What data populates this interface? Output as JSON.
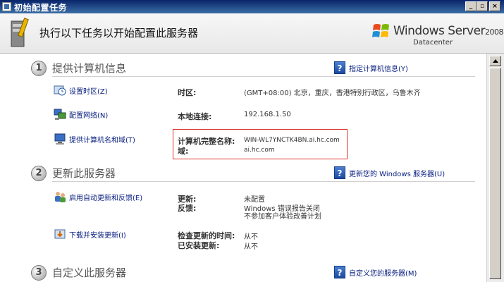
{
  "window": {
    "title": "初始配置任务"
  },
  "header": {
    "instruction": "执行以下任务以开始配置此服务器",
    "brand_name": "Windows Server",
    "brand_version": "2008",
    "brand_edition": "Datacenter"
  },
  "sections": [
    {
      "number": "1",
      "title": "提供计算机信息",
      "help_label": "指定计算机信息(Y)",
      "tasks": [
        {
          "label": "设置时区(Z)",
          "info_label": "时区:",
          "info_value": "(GMT+08:00) 北京，重庆，香港特别行政区，乌鲁木齐"
        },
        {
          "label": "配置网络(N)",
          "info_label": "本地连接:",
          "info_value": "192.168.1.50"
        },
        {
          "label": "提供计算机名和域(T)",
          "info_label": "计算机完整名称:",
          "info_value": "WIN-WL7YNCTK4BN.ai.hc.com",
          "info_label2": "域:",
          "info_value2": "ai.hc.com"
        }
      ]
    },
    {
      "number": "2",
      "title": "更新此服务器",
      "help_label": "更新您的 Windows 服务器(U)",
      "tasks": [
        {
          "label": "启用自动更新和反馈(E)",
          "info_label": "更新:",
          "info_value": "未配置",
          "info_label2": "反馈:",
          "info_value2": "Windows 错误报告关闭",
          "info_value3": "不参加客户体验改善计划"
        },
        {
          "label": "下载并安装更新(I)",
          "info_label": "检查更新的时间:",
          "info_value": "从不",
          "info_label2": "已安装更新:",
          "info_value2": "从不"
        }
      ]
    },
    {
      "number": "3",
      "title": "自定义此服务器",
      "help_label": "自定义您的服务器(M)"
    }
  ],
  "colors": {
    "link": "#0a2080",
    "highlight_border": "#e0302a",
    "titlebar": "#0a246a"
  },
  "icons": {
    "titlebar": "window-icon",
    "header": "server-tools-icon",
    "brand": "windows-flag-icon",
    "help": "help-icon",
    "time": "clock-icon",
    "network": "network-icon",
    "computer": "computer-icon",
    "update": "update-users-icon",
    "download": "download-icon"
  }
}
